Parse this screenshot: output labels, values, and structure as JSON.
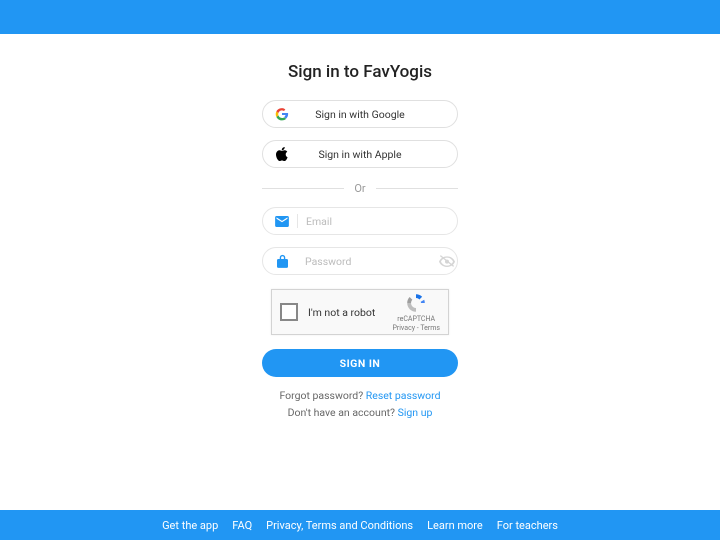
{
  "title": "Sign in to FavYogis",
  "oauth": {
    "google": "Sign in with Google",
    "apple": "Sign in with Apple"
  },
  "divider": "Or",
  "fields": {
    "email_placeholder": "Email",
    "password_placeholder": "Password"
  },
  "captcha": {
    "label": "I'm not a robot",
    "brand": "reCAPTCHA",
    "terms": "Privacy - Terms"
  },
  "submit": "SIGN IN",
  "forgot": {
    "q": "Forgot password? ",
    "link": "Reset password"
  },
  "signup": {
    "q": "Don't have an account? ",
    "link": "Sign up"
  },
  "footer": {
    "get_app": "Get the app",
    "faq": "FAQ",
    "privacy": "Privacy, Terms and Conditions",
    "learn": "Learn more",
    "teachers": "For teachers"
  },
  "colors": {
    "accent": "#2196f3"
  }
}
